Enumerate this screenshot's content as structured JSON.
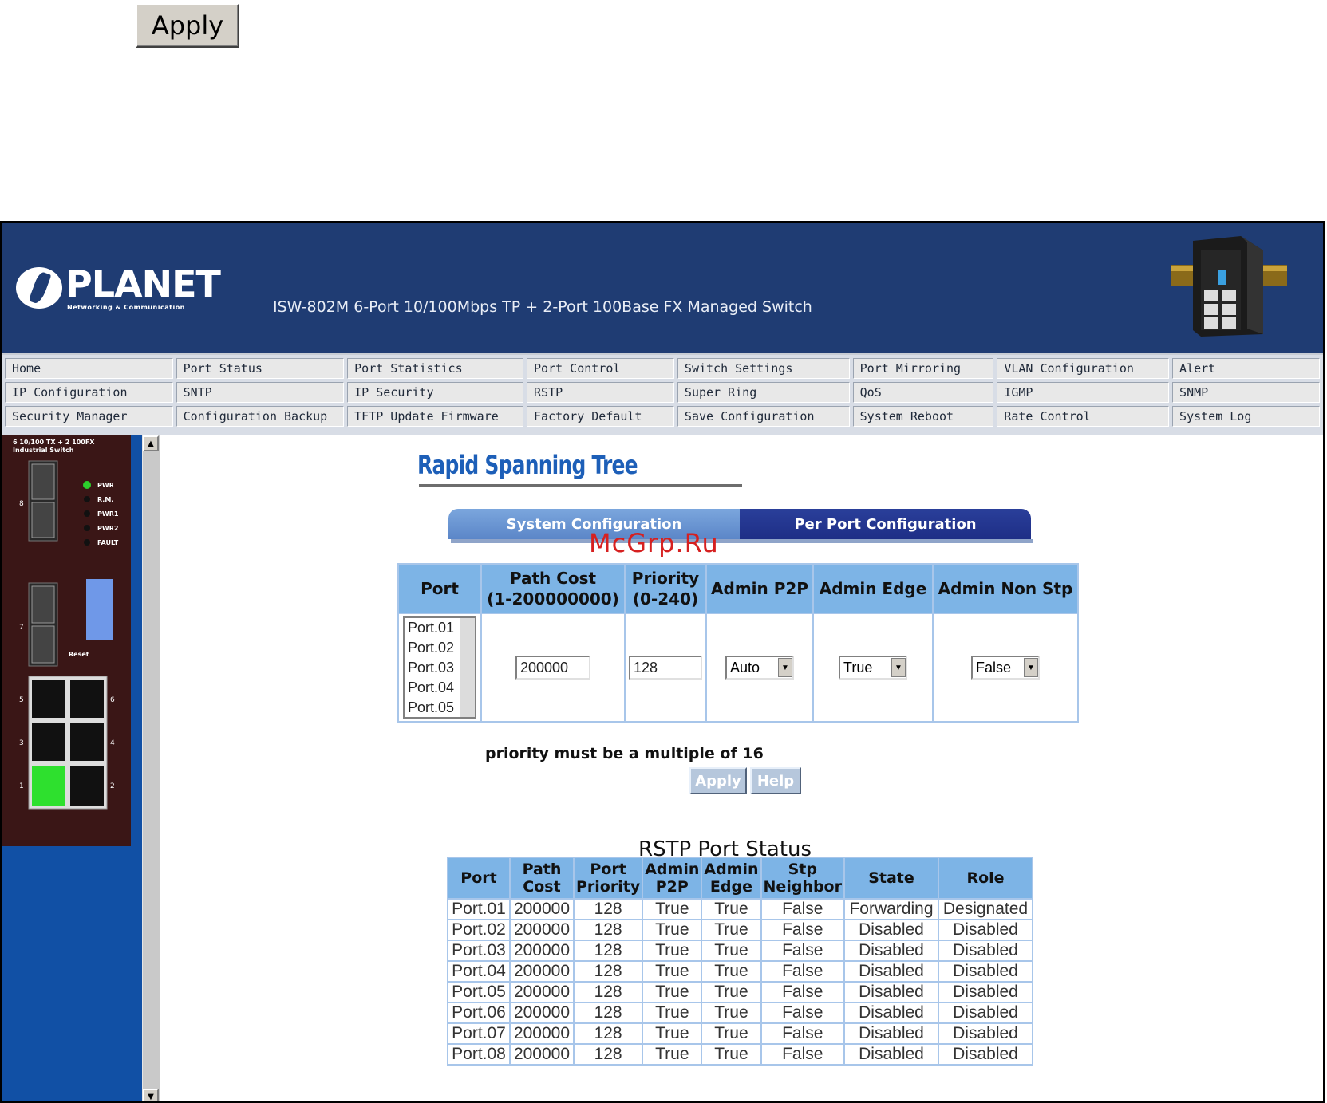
{
  "top_apply_label": "Apply",
  "header": {
    "logo_name": "PLANET",
    "logo_tagline": "Networking & Communication",
    "title": "ISW-802M 6-Port 10/100Mbps TP + 2-Port 100Base FX Managed Switch"
  },
  "menu": [
    [
      "Home",
      "Port Status",
      "Port Statistics",
      "Port Control",
      "Switch Settings",
      "Port Mirroring",
      "VLAN Configuration",
      "Alert"
    ],
    [
      "IP Configuration",
      "SNTP",
      "IP Security",
      "RSTP",
      "Super Ring",
      "QoS",
      "IGMP",
      "SNMP"
    ],
    [
      "Security Manager",
      "Configuration Backup",
      "TFTP Update Firmware",
      "Factory Default",
      "Save Configuration",
      "System Reboot",
      "Rate Control",
      "System Log"
    ]
  ],
  "panel": {
    "model": "6 10/100 TX + 2 100FX Industrial Switch",
    "leds": [
      "PWR",
      "R.M.",
      "PWR1",
      "PWR2",
      "FAULT"
    ],
    "port_labels": [
      "8",
      "7",
      "5",
      "6",
      "3",
      "4",
      "1",
      "2"
    ],
    "reset": "Reset"
  },
  "page": {
    "title": "Rapid Spanning Tree",
    "tabs": [
      "System Configuration",
      "Per Port Configuration"
    ],
    "watermark": "McGrp.Ru"
  },
  "config": {
    "headers": [
      "Port",
      "Path Cost (1-200000000)",
      "Priority (0-240)",
      "Admin P2P",
      "Admin Edge",
      "Admin Non Stp"
    ],
    "ports": [
      "Port.01",
      "Port.02",
      "Port.03",
      "Port.04",
      "Port.05"
    ],
    "path_cost": "200000",
    "priority": "128",
    "admin_p2p": "Auto",
    "admin_edge": "True",
    "admin_non_stp": "False",
    "note": "priority must be a multiple of 16",
    "apply_label": "Apply",
    "help_label": "Help"
  },
  "status": {
    "title": "RSTP Port Status",
    "headers": [
      "Port",
      "Path Cost",
      "Port Priority",
      "Admin P2P",
      "Admin Edge",
      "Stp Neighbor",
      "State",
      "Role"
    ],
    "rows": [
      [
        "Port.01",
        "200000",
        "128",
        "True",
        "True",
        "False",
        "Forwarding",
        "Designated"
      ],
      [
        "Port.02",
        "200000",
        "128",
        "True",
        "True",
        "False",
        "Disabled",
        "Disabled"
      ],
      [
        "Port.03",
        "200000",
        "128",
        "True",
        "True",
        "False",
        "Disabled",
        "Disabled"
      ],
      [
        "Port.04",
        "200000",
        "128",
        "True",
        "True",
        "False",
        "Disabled",
        "Disabled"
      ],
      [
        "Port.05",
        "200000",
        "128",
        "True",
        "True",
        "False",
        "Disabled",
        "Disabled"
      ],
      [
        "Port.06",
        "200000",
        "128",
        "True",
        "True",
        "False",
        "Disabled",
        "Disabled"
      ],
      [
        "Port.07",
        "200000",
        "128",
        "True",
        "True",
        "False",
        "Disabled",
        "Disabled"
      ],
      [
        "Port.08",
        "200000",
        "128",
        "True",
        "True",
        "False",
        "Disabled",
        "Disabled"
      ]
    ]
  }
}
